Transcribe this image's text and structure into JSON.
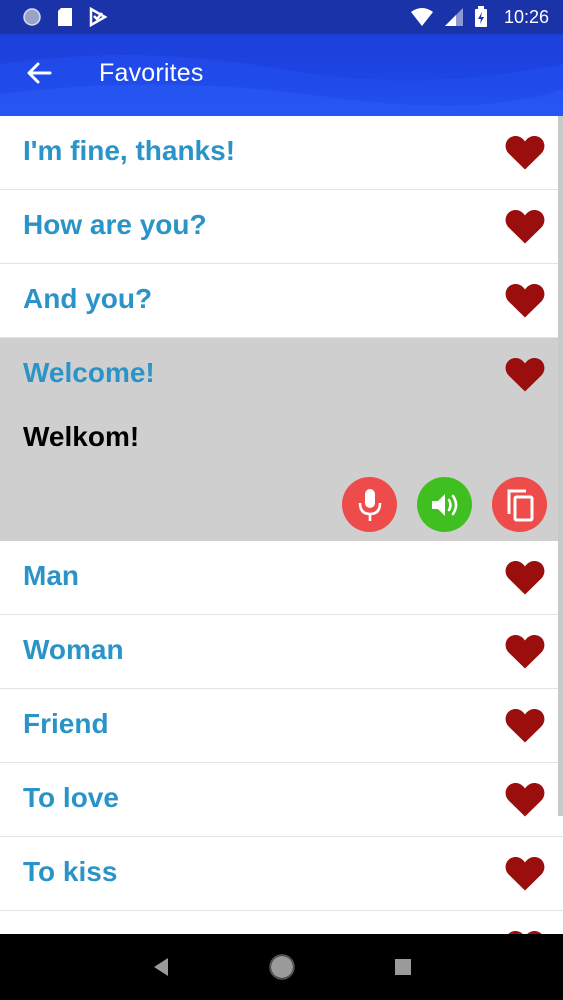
{
  "status_bar": {
    "time": "10:26",
    "icons": [
      "circle-icon",
      "sd-card-icon",
      "check-play-icon",
      "wifi-icon",
      "signal-icon",
      "battery-icon"
    ]
  },
  "app_bar": {
    "title": "Favorites",
    "back_icon": "arrow-back-icon"
  },
  "favorites": [
    {
      "phrase": "I'm fine, thanks!"
    },
    {
      "phrase": "How are you?"
    },
    {
      "phrase": "And you?"
    },
    {
      "phrase": "Welcome!",
      "translation": "Welkom!"
    },
    {
      "phrase": "Man"
    },
    {
      "phrase": "Woman"
    },
    {
      "phrase": "Friend"
    },
    {
      "phrase": "To love"
    },
    {
      "phrase": "To kiss"
    }
  ],
  "actions": {
    "record_icon": "microphone-icon",
    "play_icon": "speaker-icon",
    "copy_icon": "copy-icon"
  },
  "colors": {
    "app_bar": "#1d46e6",
    "phrase_text": "#2a93c8",
    "heart": "#9b0e0e",
    "expanded_bg": "#cfcfcf",
    "mic_button": "#ee4b4b",
    "speaker_button": "#3fbf20",
    "copy_button": "#ee4b4b"
  },
  "nav_bar": {
    "icons": [
      "back-triangle-icon",
      "home-circle-icon",
      "recents-square-icon"
    ]
  }
}
